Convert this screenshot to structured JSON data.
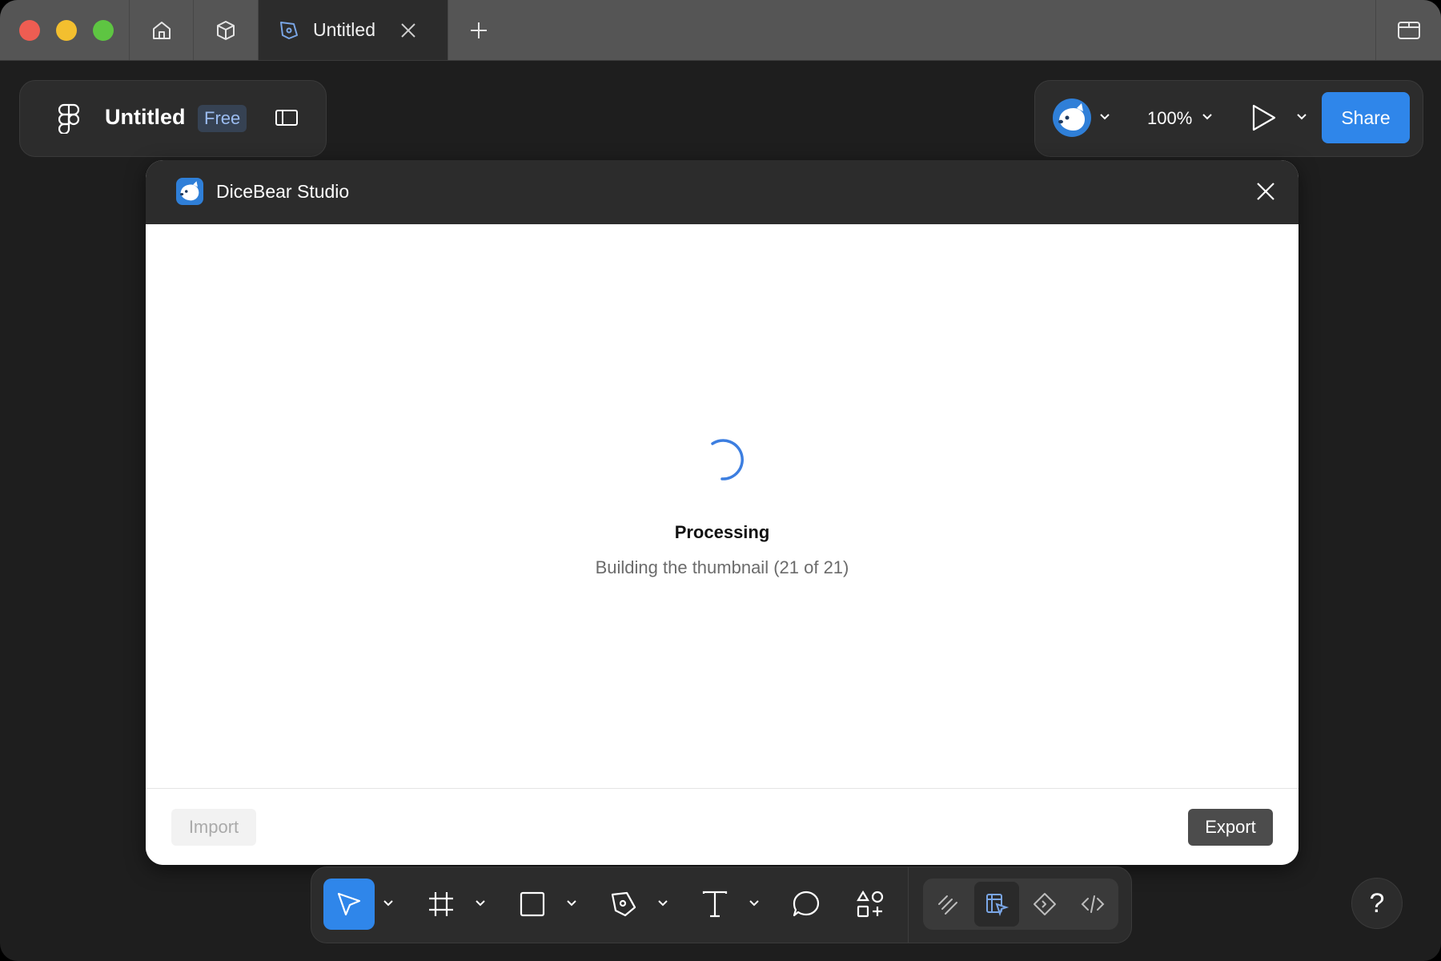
{
  "titlebar": {
    "tab": {
      "label": "Untitled",
      "icon": "pen-nib-icon"
    },
    "icons": [
      "home-icon",
      "community-icon",
      "plus-icon",
      "panel-icon"
    ]
  },
  "file": {
    "title": "Untitled",
    "plan_badge": "Free"
  },
  "header_right": {
    "zoom": "100%",
    "share_label": "Share"
  },
  "modal": {
    "title": "DiceBear Studio",
    "status_title": "Processing",
    "status_text": "Building the thumbnail (21 of 21)",
    "import_label": "Import",
    "export_label": "Export"
  },
  "toolbar": {
    "tools": [
      "move",
      "frame",
      "shape",
      "pen",
      "text",
      "comment",
      "actions"
    ],
    "modes": [
      "draw",
      "design",
      "dev",
      "code"
    ],
    "active_tool": "move",
    "active_mode": "design"
  },
  "help_label": "?",
  "colors": {
    "accent": "#2f86ea",
    "badge_bg": "#364253",
    "badge_text": "#9bbcf0"
  }
}
